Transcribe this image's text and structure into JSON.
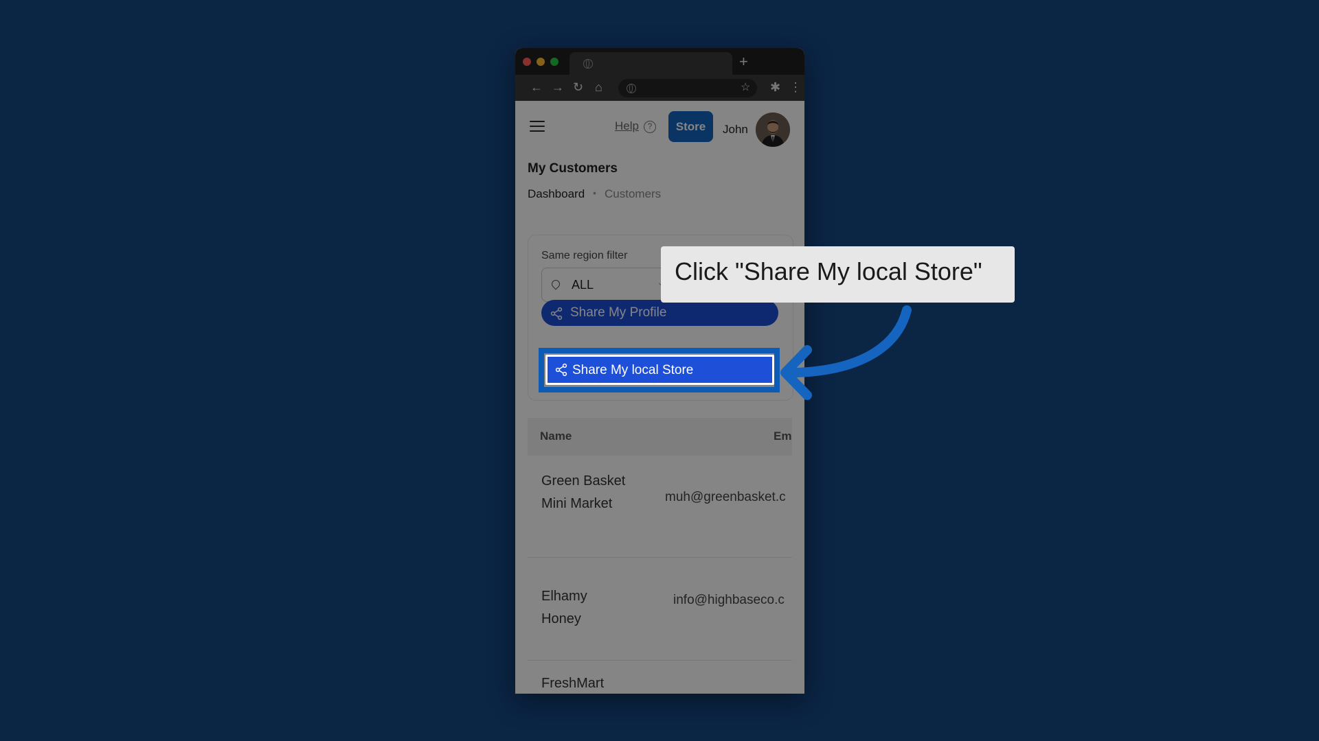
{
  "browser": {
    "new_tab_label": "+"
  },
  "header": {
    "help_label": "Help",
    "help_icon_glyph": "?",
    "store_button": "Store",
    "user_name": "John"
  },
  "page": {
    "title": "My Customers",
    "breadcrumb": [
      "Dashboard",
      "Customers"
    ],
    "breadcrumb_separator": "•"
  },
  "filter": {
    "label": "Same region filter",
    "value": "ALL"
  },
  "buttons": {
    "share_profile": "Share My Profile",
    "share_store": "Share My local Store"
  },
  "table": {
    "columns": [
      "Name",
      "Em"
    ],
    "rows": [
      {
        "name": "Green Basket Mini Market",
        "email": "muh@greenbasket.c"
      },
      {
        "name": "Elhamy Honey",
        "email": "info@highbaseco.c"
      },
      {
        "name": "FreshMart",
        "email": ""
      }
    ]
  },
  "callout": {
    "text": "Click \"Share My local Store\""
  },
  "colors": {
    "background": "#0b2545",
    "accent_blue": "#1565c0",
    "button_blue": "#1e4fd8",
    "highlight_blue": "#0d5bb5"
  }
}
